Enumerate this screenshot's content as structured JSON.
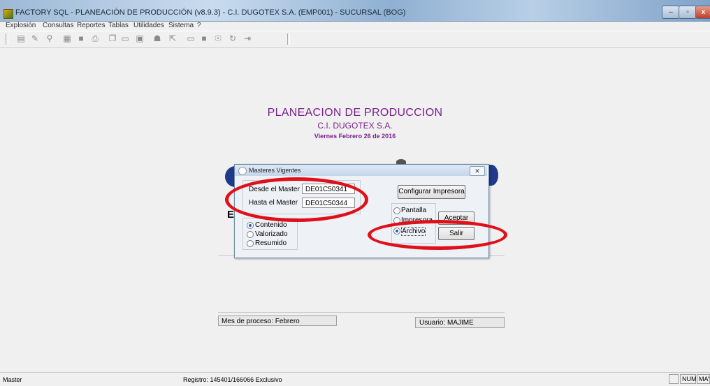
{
  "window": {
    "title": "FACTORY SQL - PLANEACIÓN DE PRODUCCIÓN (v8.9.3) - C.I. DUGOTEX S.A. (EMP001) - SUCURSAL (BOG)",
    "minimize": "–",
    "maximize": "▫",
    "close": "x"
  },
  "menu": [
    "Explosión",
    "Consultas",
    "Reportes",
    "Tablas",
    "Utilidades",
    "Sistema",
    "?"
  ],
  "toolbar_icons": [
    "new-icon",
    "edit-icon",
    "search-icon",
    "print-preview-icon",
    "save-icon",
    "print-icon",
    "copy-icon",
    "open-folder-icon",
    "calculator-icon",
    "users-icon",
    "export-icon",
    "minus-icon",
    "stop-icon",
    "help-icon",
    "refresh-icon",
    "exit-icon"
  ],
  "main": {
    "heading": "PLANEACION DE PRODUCCION",
    "company": "C.I. DUGOTEX S.A.",
    "date": "Viernes Febrero 26 de 2016",
    "bg_letter": "E"
  },
  "dialog": {
    "title": "Masteres Vigentes",
    "close_label": "✕",
    "from_label": "Desde el Master",
    "from_value": "DE01C50341",
    "to_label": "Hasta el Master",
    "to_value": "DE01C50344",
    "configure_label": "Configurar Impresora",
    "type_options": [
      {
        "label": "Contenido",
        "selected": true
      },
      {
        "label": "Valorizado",
        "selected": false
      },
      {
        "label": "Resumido",
        "selected": false
      }
    ],
    "output_options": [
      {
        "label": "Pantalla",
        "selected": false
      },
      {
        "label": "Impresora",
        "selected": false
      },
      {
        "label": "Archivo",
        "selected": true
      }
    ],
    "accept_label": "Aceptar",
    "exit_label": "Salir"
  },
  "info": {
    "month": "Mes de proceso: Febrero",
    "user": "Usuario:  MAJIME"
  },
  "status": {
    "left": "Master",
    "record": "Registro: 145401/166066  Exclusivo",
    "num": "NUM",
    "cap": "MAY"
  },
  "colors": {
    "accent_purple": "#7b1f8e",
    "annotation_red": "#e0101a",
    "logo_blue": "#1e3a8a"
  }
}
